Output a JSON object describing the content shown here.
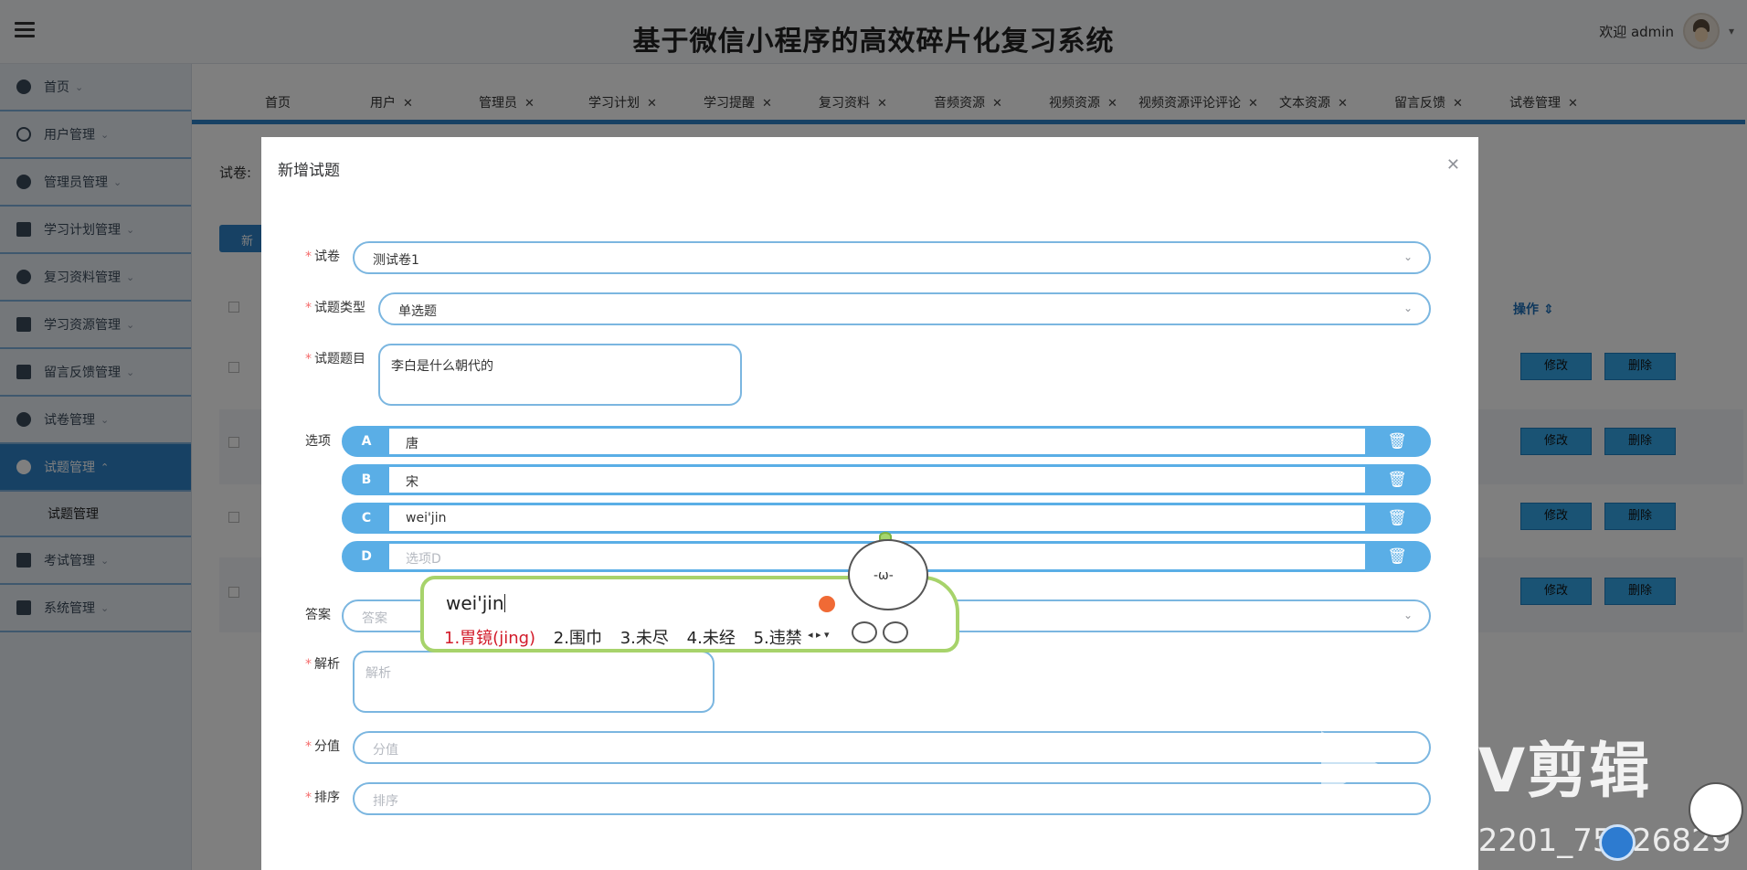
{
  "header": {
    "title": "基于微信小程序的高效碎片化复习系统",
    "welcome": "欢迎 admin"
  },
  "sidebar": {
    "items": [
      {
        "label": "首页"
      },
      {
        "label": "用户管理"
      },
      {
        "label": "管理员管理"
      },
      {
        "label": "学习计划管理"
      },
      {
        "label": "复习资料管理"
      },
      {
        "label": "学习资源管理"
      },
      {
        "label": "留言反馈管理"
      },
      {
        "label": "试卷管理"
      },
      {
        "label": "试题管理"
      },
      {
        "label": "考试管理"
      },
      {
        "label": "系统管理"
      }
    ],
    "submenu": {
      "label": "试题管理"
    }
  },
  "tabs": [
    {
      "label": "首页"
    },
    {
      "label": "用户"
    },
    {
      "label": "管理员"
    },
    {
      "label": "学习计划"
    },
    {
      "label": "学习提醒"
    },
    {
      "label": "复习资料"
    },
    {
      "label": "音频资源"
    },
    {
      "label": "视频资源"
    },
    {
      "label": "视频资源评论评论"
    },
    {
      "label": "文本资源"
    },
    {
      "label": "留言反馈"
    },
    {
      "label": "试卷管理"
    }
  ],
  "page": {
    "filter_label": "试卷:",
    "new_button": "新",
    "operation_header": "操作",
    "edit_label": "修改",
    "delete_label": "删除"
  },
  "dialog": {
    "title": "新增试题",
    "fields": {
      "paper": {
        "label": "试卷",
        "value": "测试卷1"
      },
      "type": {
        "label": "试题类型",
        "value": "单选题"
      },
      "question": {
        "label": "试题题目",
        "value": "李白是什么朝代的"
      },
      "options_label": "选项",
      "answer": {
        "label": "答案",
        "placeholder": "答案"
      },
      "analysis": {
        "label": "解析",
        "placeholder": "解析"
      },
      "score": {
        "label": "分值",
        "placeholder": "分值"
      },
      "sort": {
        "label": "排序",
        "placeholder": "排序"
      }
    },
    "options": [
      {
        "letter": "A",
        "value": "唐"
      },
      {
        "letter": "B",
        "value": "宋"
      },
      {
        "letter": "C",
        "value": "wei'jin"
      },
      {
        "letter": "D",
        "placeholder": "选项D"
      }
    ]
  },
  "ime": {
    "composition": "wei'jin",
    "candidates": [
      "1.胃镜(jing)",
      "2.围巾",
      "3.未尽",
      "4.未经",
      "5.违禁"
    ]
  },
  "watermarks": {
    "jianying": "剪辑",
    "csdn": "CSDN @2201_75926829"
  },
  "colors": {
    "accent": "#2e83c9",
    "input_border": "#7bb6e0",
    "option_bar": "#5aaee6",
    "required": "#f56c6c",
    "ime_border": "#a7d36b"
  }
}
